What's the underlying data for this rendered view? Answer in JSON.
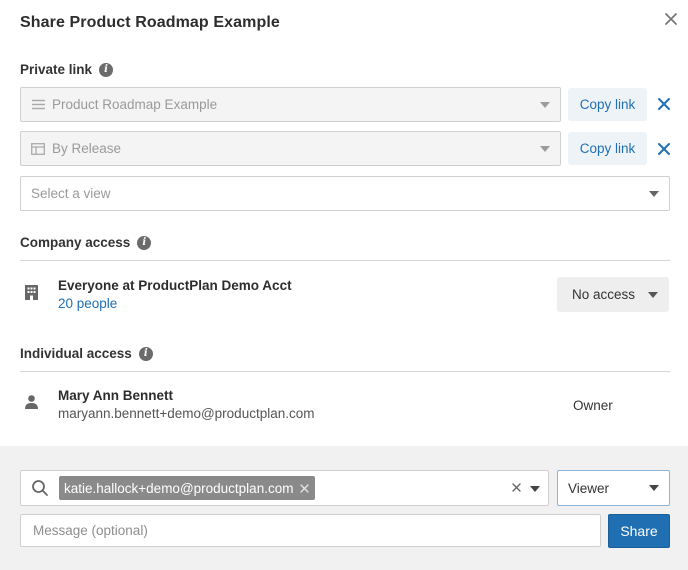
{
  "dialog": {
    "title": "Share Product Roadmap Example"
  },
  "private_link": {
    "label": "Private link",
    "roadmap_select": {
      "value": "Product Roadmap Example",
      "icon": "list-icon"
    },
    "view_select": {
      "value": "By Release",
      "icon": "columns-icon"
    },
    "new_view_select": {
      "placeholder": "Select a view"
    },
    "copy_label": "Copy link"
  },
  "company_access": {
    "label": "Company access",
    "org_name": "Everyone at ProductPlan Demo Acct",
    "people_count": "20 people",
    "access_level": "No access",
    "icon": "building-icon"
  },
  "individual_access": {
    "label": "Individual access",
    "users": [
      {
        "name": "Mary Ann Bennett",
        "email": "maryann.bennett+demo@productplan.com",
        "role": "Owner",
        "icon": "person-icon"
      }
    ]
  },
  "invite": {
    "chip_email": "katie.hallock+demo@productplan.com",
    "role": "Viewer",
    "message_placeholder": "Message (optional)",
    "share_label": "Share"
  },
  "colors": {
    "accent": "#1f6fb2",
    "copy_button_bg": "#eef3f8",
    "footer_bg": "#f1f1f1",
    "chip_bg": "#8a8a8a"
  }
}
